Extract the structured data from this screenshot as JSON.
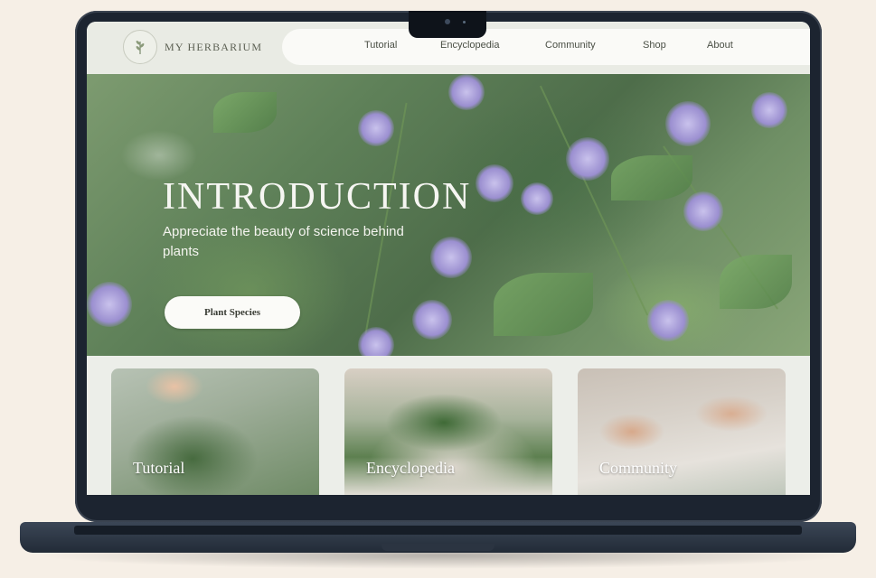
{
  "brand": {
    "name": "MY HERBARIUM",
    "logo_icon": "leaf-sprig-icon"
  },
  "nav": {
    "items": [
      {
        "label": "Tutorial"
      },
      {
        "label": "Encyclopedia"
      },
      {
        "label": "Community"
      },
      {
        "label": "Shop"
      },
      {
        "label": "About"
      }
    ]
  },
  "hero": {
    "title": "INTRODUCTION",
    "subtitle": "Appreciate the beauty of science behind plants",
    "cta_label": "Plant Species"
  },
  "cards": [
    {
      "label": "Tutorial"
    },
    {
      "label": "Encyclopedia"
    },
    {
      "label": "Community"
    }
  ],
  "colors": {
    "page_bg": "#f6efe6",
    "header_bg": "#e9ebe4",
    "nav_pill": "#fafaf7",
    "accent_green": "#5f8159",
    "lavender": "#9b8fd0",
    "laptop": "#1c2430"
  }
}
